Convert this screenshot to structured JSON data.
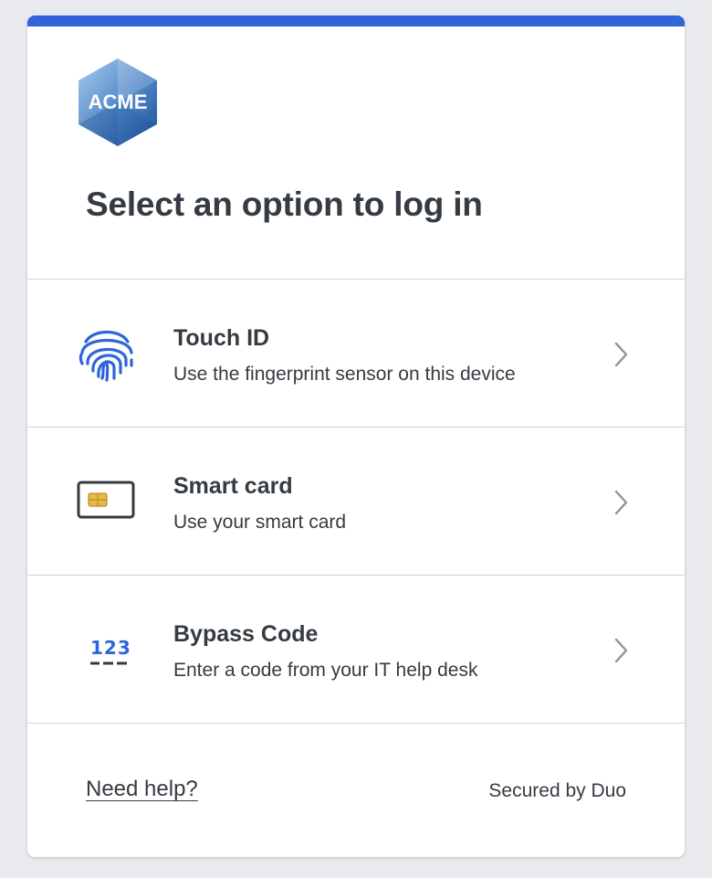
{
  "logo": {
    "text": "ACME",
    "icon": "acme-hexagon-logo"
  },
  "heading": "Select an option to log in",
  "options": [
    {
      "title": "Touch ID",
      "description": "Use the fingerprint sensor on this device",
      "icon": "fingerprint-icon"
    },
    {
      "title": "Smart card",
      "description": "Use your smart card",
      "icon": "smart-card-icon"
    },
    {
      "title": "Bypass Code",
      "description": "Enter a code from your IT help desk",
      "icon": "bypass-code-icon",
      "icon_text": "123"
    }
  ],
  "footer": {
    "help_link": "Need help?",
    "secured_by": "Secured by Duo"
  },
  "colors": {
    "accent": "#2f65d8",
    "text": "#353b42",
    "chevron": "#8a94a0",
    "chip": "#e8b84a"
  }
}
